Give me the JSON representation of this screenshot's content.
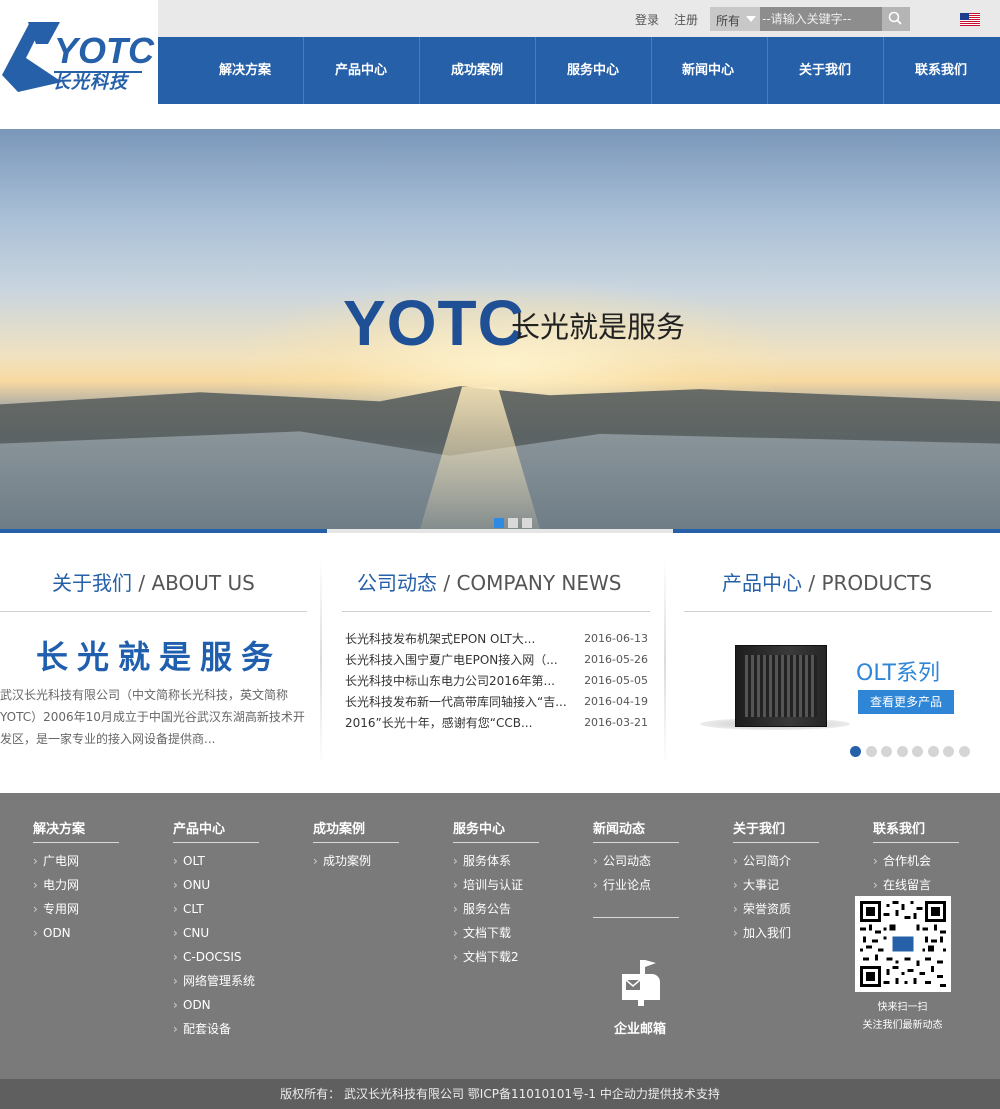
{
  "header": {
    "login_label": "登录",
    "register_label": "注册",
    "search": {
      "scope_label": "所有",
      "placeholder": "--请输入关键字--"
    },
    "logo": {
      "brand": "YOTC",
      "name_cn": "长光科技"
    }
  },
  "nav": {
    "items": [
      "解决方案",
      "产品中心",
      "成功案例",
      "服务中心",
      "新闻中心",
      "关于我们",
      "联系我们"
    ]
  },
  "banner": {
    "brand": "YOTC",
    "slogan": "长光就是服务",
    "slide_count": 3,
    "active_slide": 1
  },
  "about": {
    "title_cn": "关于我们",
    "title_en": "/ ABOUT US",
    "slogan": "长光就是服务",
    "text": "武汉长光科技有限公司（中文简称长光科技，英文简称YOTC）2006年10月成立于中国光谷武汉东湖高新技术开发区，是一家专业的接入网设备提供商..."
  },
  "news": {
    "title_cn": "公司动态",
    "title_en": "/ COMPANY NEWS",
    "items": [
      {
        "title": "长光科技发布机架式EPON OLT大...",
        "date": "2016-06-13"
      },
      {
        "title": "长光科技入围宁夏广电EPON接入网（...",
        "date": "2016-05-26"
      },
      {
        "title": "长光科技中标山东电力公司2016年第...",
        "date": "2016-05-05"
      },
      {
        "title": "长光科技发布新一代高带库同轴接入“吉...",
        "date": "2016-04-19"
      },
      {
        "title": "2016”长光十年，感谢有您“CCB...",
        "date": "2016-03-21"
      }
    ]
  },
  "products": {
    "title_cn": "产品中心",
    "title_en": "/ PRODUCTS",
    "banner_title": "OLT系列",
    "banner_button": "查看更多产品",
    "slide_count": 9,
    "active_slide": 1
  },
  "footer": {
    "columns": [
      {
        "title": "解决方案",
        "links": [
          "广电网",
          "电力网",
          "专用网",
          "ODN"
        ]
      },
      {
        "title": "产品中心",
        "links": [
          "OLT",
          "ONU",
          "CLT",
          "CNU",
          "C-DOCSIS",
          "网络管理系统",
          "ODN",
          "配套设备"
        ]
      },
      {
        "title": "成功案例",
        "links": [
          "成功案例"
        ]
      },
      {
        "title": "服务中心",
        "links": [
          "服务体系",
          "培训与认证",
          "服务公告",
          "文档下载",
          "文档下载2"
        ]
      },
      {
        "title": "新闻动态",
        "links": [
          "公司动态",
          "行业论点"
        ]
      },
      {
        "title": "关于我们",
        "links": [
          "公司简介",
          "大事记",
          "荣誉资质",
          "加入我们"
        ]
      },
      {
        "title": "联系我们",
        "links": [
          "合作机会",
          "在线留言"
        ]
      }
    ],
    "mail_label": "企业邮箱",
    "qr_caption_1": "快来扫一扫",
    "qr_caption_2": "关注我们最新动态",
    "copyright": "版权所有：  武汉长光科技有限公司  鄂ICP备11010101号-1    中企动力提供技术支持"
  },
  "colors": {
    "primary": "#2660a9",
    "accent": "#2f86d6",
    "footer_bg": "#7a7a7a",
    "copyright_bg": "#5f5f5f"
  },
  "icons": [
    "search-icon",
    "us-flag-icon",
    "mailbox-icon",
    "qr-code",
    "chevron-right-icon"
  ]
}
